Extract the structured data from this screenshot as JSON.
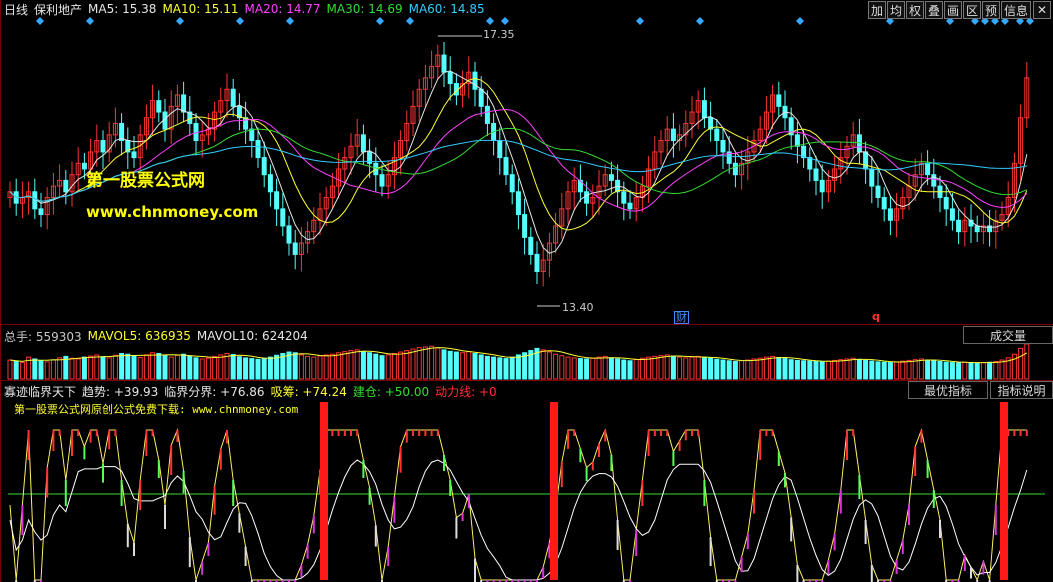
{
  "ma_header": {
    "period": "日线",
    "stock_name": "保利地产",
    "ma5": "MA5: 15.38",
    "ma10": "MA10: 15.11",
    "ma20": "MA20: 14.77",
    "ma30": "MA30: 14.69",
    "ma60": "MA60: 14.85"
  },
  "toolbar": {
    "buttons": [
      "加",
      "均",
      "权",
      "叠",
      "画",
      "区",
      "预",
      "信息"
    ],
    "close": "✕"
  },
  "watermark": {
    "line1": "第一股票公式网",
    "line2": "www.chnmoney.com"
  },
  "price_annotations": {
    "high": "17.35",
    "low": "13.40",
    "finance_marker": "财",
    "q_marker": "q"
  },
  "volume_header": {
    "total": "总手: 559303",
    "mavol5": "MAVOL5: 636935",
    "mavol10": "MAVOL10: 624204"
  },
  "volume_tab": "成交量",
  "indicator_header": {
    "name": "寡迹临界天下",
    "trend": "趋势: +39.93",
    "critical": "临界分界: +76.86",
    "absorb": "吸筹: +74.24",
    "build": "建仓: +50.00",
    "power": "动力线: +0"
  },
  "indicator_tabs": {
    "best": "最优指标",
    "desc": "指标说明"
  },
  "indicator_subtitle": "第一股票公式网原创公式免费下载: www.chnmoney.com",
  "chart_data": {
    "type": "candlestick",
    "price_range": [
      13.0,
      17.6
    ],
    "high": 17.35,
    "low": 13.4,
    "colors": {
      "up": "#ff3333",
      "down": "#54ffff",
      "ma5": "#e6e6e6",
      "ma10": "#ffff33",
      "ma20": "#ff40ff",
      "ma30": "#33dd33",
      "ma60": "#33ccff"
    },
    "closes": [
      14.9,
      14.7,
      14.8,
      14.9,
      14.6,
      14.5,
      14.8,
      15.0,
      15.1,
      14.9,
      15.2,
      15.4,
      15.3,
      15.6,
      15.8,
      15.6,
      15.9,
      16.1,
      15.8,
      15.6,
      15.5,
      15.9,
      16.2,
      16.5,
      16.3,
      16.0,
      16.4,
      16.6,
      16.3,
      16.1,
      15.8,
      15.9,
      16.0,
      16.3,
      16.5,
      16.7,
      16.4,
      16.2,
      16.0,
      15.8,
      15.5,
      15.2,
      14.9,
      14.6,
      14.3,
      14.0,
      13.8,
      14.0,
      14.2,
      14.4,
      14.6,
      14.8,
      15.0,
      15.3,
      15.5,
      15.7,
      15.9,
      15.6,
      15.4,
      15.2,
      15.0,
      15.2,
      15.5,
      15.8,
      16.1,
      16.4,
      16.7,
      16.9,
      17.1,
      17.3,
      17.0,
      16.8,
      16.6,
      16.8,
      17.0,
      16.7,
      16.4,
      16.1,
      15.8,
      15.5,
      15.2,
      14.9,
      14.5,
      14.1,
      13.8,
      13.5,
      13.7,
      14.0,
      14.3,
      14.6,
      14.9,
      15.1,
      14.9,
      14.7,
      14.8,
      15.0,
      15.2,
      15.1,
      14.9,
      14.7,
      14.6,
      14.8,
      15.0,
      15.3,
      15.6,
      15.8,
      16.0,
      15.8,
      15.9,
      16.1,
      16.3,
      16.5,
      16.2,
      16.0,
      15.8,
      15.6,
      15.4,
      15.2,
      15.4,
      15.6,
      15.8,
      16.0,
      16.3,
      16.6,
      16.4,
      16.2,
      15.9,
      15.7,
      15.5,
      15.3,
      15.1,
      14.9,
      15.1,
      15.3,
      15.5,
      15.7,
      15.9,
      15.6,
      15.3,
      15.0,
      14.8,
      14.6,
      14.4,
      14.6,
      14.8,
      15.0,
      15.2,
      15.4,
      15.2,
      15.0,
      14.8,
      14.6,
      14.4,
      14.2,
      14.4,
      14.3,
      14.2,
      14.3,
      14.2,
      14.4,
      14.5,
      14.8,
      15.4,
      16.2,
      16.9
    ],
    "volumes": [
      52,
      48,
      45,
      60,
      55,
      50,
      47,
      52,
      58,
      62,
      57,
      55,
      60,
      63,
      66,
      61,
      58,
      65,
      70,
      68,
      62,
      59,
      66,
      72,
      70,
      64,
      60,
      65,
      68,
      63,
      58,
      55,
      57,
      62,
      66,
      70,
      67,
      61,
      58,
      56,
      54,
      57,
      60,
      65,
      70,
      74,
      72,
      66,
      62,
      60,
      63,
      66,
      68,
      72,
      75,
      78,
      80,
      76,
      72,
      68,
      64,
      66,
      70,
      74,
      78,
      82,
      86,
      88,
      90,
      85,
      80,
      76,
      74,
      72,
      75,
      70,
      66,
      62,
      60,
      58,
      56,
      60,
      66,
      72,
      78,
      84,
      80,
      74,
      68,
      64,
      60,
      58,
      56,
      55,
      57,
      60,
      62,
      58,
      55,
      52,
      50,
      54,
      57,
      60,
      62,
      64,
      66,
      63,
      60,
      58,
      60,
      62,
      60,
      57,
      54,
      52,
      50,
      48,
      50,
      52,
      55,
      57,
      60,
      62,
      59,
      56,
      53,
      51,
      50,
      49,
      48,
      47,
      49,
      51,
      53,
      55,
      57,
      54,
      51,
      49,
      47,
      46,
      45,
      47,
      49,
      51,
      53,
      55,
      52,
      50,
      48,
      46,
      45,
      44,
      46,
      45,
      44,
      45,
      46,
      48,
      52,
      58,
      68,
      84,
      96
    ]
  }
}
